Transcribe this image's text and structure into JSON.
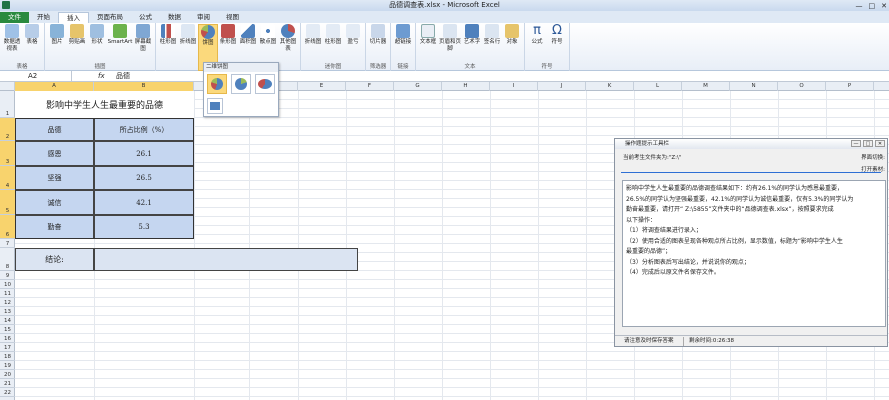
{
  "window": {
    "title": "品德调查表.xlsx - Microsoft Excel",
    "controls": [
      "—",
      "□",
      "✕"
    ]
  },
  "tabs": [
    "文件",
    "开始",
    "插入",
    "页面布局",
    "公式",
    "数据",
    "审阅",
    "视图"
  ],
  "ribbon": {
    "groups": [
      {
        "label": "表格",
        "buttons": [
          "数据透视表",
          "表格"
        ]
      },
      {
        "label": "插图",
        "buttons": [
          "图片",
          "剪贴画",
          "形状",
          "SmartArt",
          "屏幕截图"
        ]
      },
      {
        "label": "",
        "buttons": [
          "柱形图",
          "折线图",
          "饼图",
          "条形图",
          "面积图",
          "散点图",
          "其他图表"
        ]
      },
      {
        "label": "迷你图",
        "buttons": [
          "折线图",
          "柱形图",
          "盈亏"
        ]
      },
      {
        "label": "筛选器",
        "buttons": [
          "切片器"
        ]
      },
      {
        "label": "链接",
        "buttons": [
          "超链接"
        ]
      },
      {
        "label": "文本",
        "buttons": [
          "文本框",
          "页眉和页脚",
          "艺术字",
          "签名行",
          "对象"
        ]
      },
      {
        "label": "符号",
        "buttons": [
          "公式",
          "符号"
        ]
      }
    ]
  },
  "formula_bar": {
    "name_box": "A2",
    "fx": "fx",
    "value": "品德"
  },
  "columns": [
    "A",
    "B",
    "C",
    "D",
    "E",
    "F",
    "G",
    "H",
    "I",
    "J",
    "K",
    "L",
    "M",
    "N",
    "O",
    "P",
    "Q",
    "R",
    "S",
    "T",
    "U"
  ],
  "rows": [
    "1",
    "2",
    "3",
    "4",
    "5",
    "6",
    "7",
    "8",
    "9",
    "10",
    "11",
    "12",
    "13",
    "14",
    "15",
    "16",
    "17",
    "18",
    "19",
    "20",
    "21",
    "22",
    "23",
    "24",
    "25",
    "26",
    "27",
    "28",
    "29",
    "30",
    "31",
    "32",
    "33",
    "34",
    "35",
    "36",
    "37",
    "38"
  ],
  "sheet": {
    "title": "影响中学生人生最重要的品德",
    "header": [
      "品德",
      "所占比例（%）"
    ],
    "rows": [
      [
        "感恩",
        "26.1"
      ],
      [
        "坚强",
        "26.5"
      ],
      [
        "诚信",
        "42.1"
      ],
      [
        "勤奋",
        "5.3"
      ]
    ],
    "conclusion_label": "结论:"
  },
  "gallery": {
    "title": "二维饼图"
  },
  "panel": {
    "title": "操作题提示工具栏",
    "file_info": "当前考生文件夹为:\"Z:\\\"",
    "switch_label": "界面切换:",
    "open_label": "打开素材:",
    "instructions": [
      "影响中学生人生最重要的品德调查结果如下：约有26.1%的同学认为感恩最重要，",
      "26.5%的同学认为坚强最重要，42.1%的同学认为诚信最重要，仅有5.3%的同学认为",
      "勤奋最重要，请打开“ Z:\\5855”文件夹中的“品德调查表.xlsx”，按照要求完成",
      "以下操作：",
      "（1）将调查结果进行录入；",
      "（2）使用合适的图表呈现各种观点所占比例，显示数值，标题为“影响中学生人生",
      "最重要的品德”；",
      "（3）分析图表后写出结论，并说说你的观点；",
      "（4）完成后以原文件名保存文件。"
    ],
    "save_button": "请注意及时保存答案",
    "time_left": "剩余时间:0:26:38"
  }
}
